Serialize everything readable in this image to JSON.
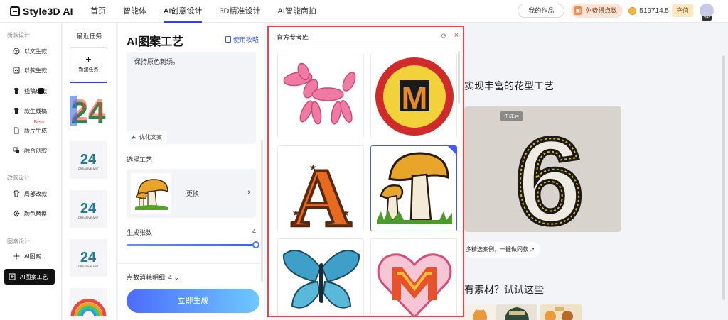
{
  "app": {
    "logo_text": "Style3D AI"
  },
  "nav": {
    "items": [
      "首页",
      "智能体",
      "AI创意设计",
      "3D精准设计",
      "AI智能商拍"
    ],
    "active_index": 2
  },
  "topbar": {
    "my_works": "我的作品",
    "free_points": "免费得点数",
    "points": "519714.5",
    "recharge": "充值",
    "vip": "VIP"
  },
  "sidebar": {
    "sections": [
      {
        "title": "新款设计",
        "items": [
          {
            "label": "以文生款",
            "icon": "text-icon"
          },
          {
            "label": "以款生款",
            "icon": "style-icon"
          },
          {
            "label": "线稿成款",
            "icon": "sketch-icon"
          },
          {
            "label": "款生线稿",
            "icon": "shirt-icon"
          },
          {
            "label": "版片生成",
            "icon": "pattern-icon",
            "badge": "Beta"
          },
          {
            "label": "融合创款",
            "icon": "merge-icon"
          }
        ]
      },
      {
        "title": "改款设计",
        "items": [
          {
            "label": "局部改款",
            "icon": "partial-icon"
          },
          {
            "label": "颜色替换",
            "icon": "color-icon"
          }
        ]
      },
      {
        "title": "图案设计",
        "items": [
          {
            "label": "AI图案",
            "icon": "ai-pattern-icon"
          },
          {
            "label": "AI图案工艺",
            "icon": "ai-craft-icon",
            "active": true
          }
        ]
      }
    ]
  },
  "recent": {
    "title": "最近任务",
    "new_task": "新建任务",
    "thumb_text": "CREATIVE ART",
    "thumb_number": "24"
  },
  "panel": {
    "title": "AI图案工艺",
    "guide": "使用攻略",
    "prompt": "保持原色刺绣。",
    "optimize": "优化文案",
    "craft_label": "选择工艺",
    "craft_change": "更换",
    "count_label": "生成张数",
    "count_value": "4",
    "count_fraction": 1.0,
    "cost": "点数消耗明细: 4",
    "generate": "立即生成"
  },
  "gallery": {
    "title": "官方参考库",
    "items": [
      "balloon-dog",
      "letter-m-patch",
      "letter-a-patch",
      "mushroom-patch",
      "butterfly-patch",
      "heart-m-patch"
    ],
    "selected_index": 3,
    "letter_m": "M",
    "letter_a": "A"
  },
  "main": {
    "heading": "实现丰富的花型工艺",
    "after_badge": "生成后",
    "preview_digit": "6",
    "more": "多精选案例，一键做同款",
    "try": "有素材？试试这些"
  },
  "colors": {
    "accent": "#2f3bff",
    "highlight_border": "#e3474a",
    "generate_start": "#4c6bff",
    "generate_end": "#6ec9ff"
  }
}
